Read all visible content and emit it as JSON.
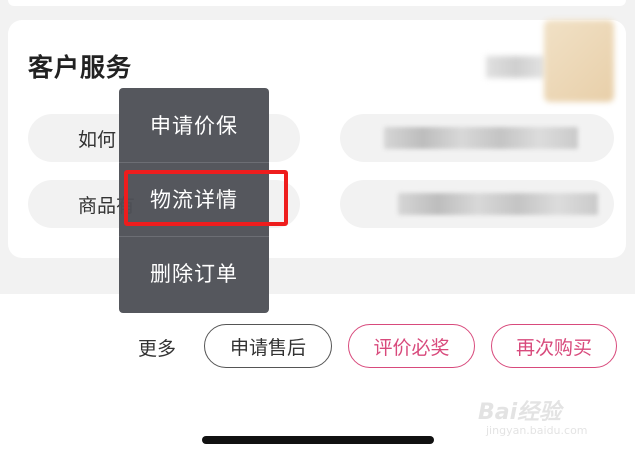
{
  "customer_service": {
    "title": "客户服务",
    "questions": [
      {
        "label": "如何"
      },
      {
        "label": "商品有"
      }
    ]
  },
  "popup_menu": {
    "items": [
      {
        "label": "申请价保"
      },
      {
        "label": "物流详情",
        "highlighted": true
      },
      {
        "label": "删除订单"
      }
    ]
  },
  "actions": {
    "more_label": "更多",
    "after_sale_label": "申请售后",
    "review_label": "评价必奖",
    "rebuy_label": "再次购买"
  },
  "watermark": {
    "logo": "Bai经验",
    "sub": "jingyan.baidu.com"
  },
  "colors": {
    "accent": "#d84a7c",
    "highlight": "#ee1d1d",
    "popup_bg": "#4e5056"
  }
}
